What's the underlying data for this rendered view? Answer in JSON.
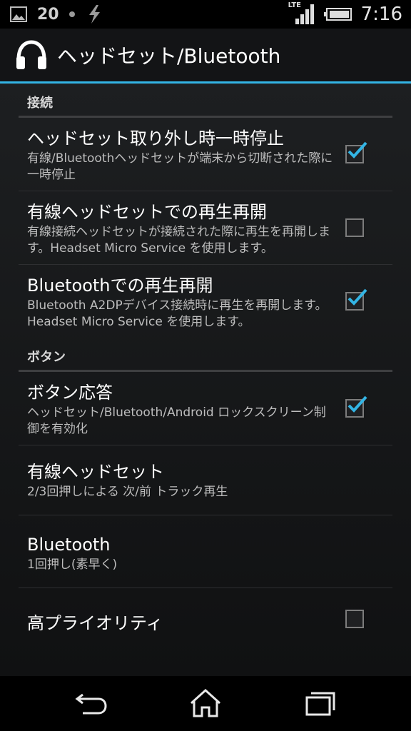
{
  "status_bar": {
    "notification_count": "20",
    "network_type": "LTE",
    "time": "7:16",
    "icons": [
      "image-icon",
      "dot-icon",
      "bolt-icon",
      "lte-signal-icon",
      "battery-icon"
    ]
  },
  "action_bar": {
    "icon": "headphones-icon",
    "title": "ヘッドセット/Bluetooth",
    "accent_color": "#33b5e5"
  },
  "sections": [
    {
      "header": "接続",
      "items": [
        {
          "title": "ヘッドセット取り外し時一時停止",
          "summary": "有線/Bluetoothヘッドセットが端末から切断された際に一時停止",
          "checked": true
        },
        {
          "title": "有線ヘッドセットでの再生再開",
          "summary": "有線接続ヘッドセットが接続された際に再生を再開します。Headset Micro Service を使用します。",
          "checked": false
        },
        {
          "title": "Bluetoothでの再生再開",
          "summary": "Bluetooth A2DPデバイス接続時に再生を再開します。Headset Micro Service を使用します。",
          "checked": true
        }
      ]
    },
    {
      "header": "ボタン",
      "items": [
        {
          "title": "ボタン応答",
          "summary": "ヘッドセット/Bluetooth/Android ロックスクリーン制御を有効化",
          "checked": true
        },
        {
          "title": "有線ヘッドセット",
          "summary": "2/3回押しによる 次/前 トラック再生"
        },
        {
          "title": "Bluetooth",
          "summary": "1回押し(素早く)"
        },
        {
          "title": "高プライオリティ",
          "summary": "",
          "checked": false
        }
      ]
    }
  ],
  "nav_bar": {
    "icons": [
      "back-icon",
      "home-icon",
      "recents-icon"
    ]
  }
}
